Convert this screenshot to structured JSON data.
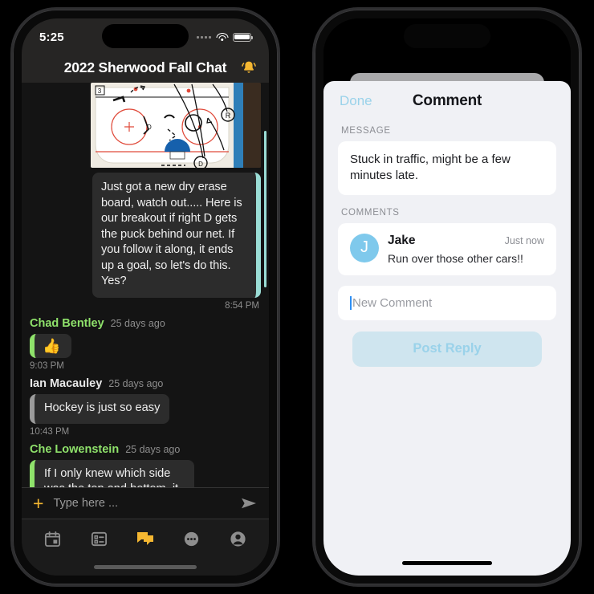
{
  "left_phone": {
    "status_bar": {
      "time": "5:25",
      "wifi_icon": "wifi-icon",
      "battery_icon": "battery-full-icon",
      "cellular_icon": "cellular-dots-icon"
    },
    "nav": {
      "title": "2022 Sherwood Fall Chat",
      "bell_icon": "bell-icon"
    },
    "messages": [
      {
        "type": "image",
        "name": "whiteboard-photo",
        "alt": "hockey rink breakout diagram on dry erase board"
      },
      {
        "type": "outgoing",
        "text": "Just got a new dry erase board, watch out..... Here is our breakout if right D gets the puck behind our net. If you follow it along, it ends up a goal, so let's do this. Yes?",
        "time": "8:54 PM",
        "accent": "#9bddd6"
      },
      {
        "type": "incoming",
        "author": "Chad Bentley",
        "ago": "25 days ago",
        "text": "👍",
        "time": "9:03 PM",
        "accent": "#8fe26b",
        "name_color": "#8fe26b",
        "is_reaction": true
      },
      {
        "type": "incoming",
        "author": "Ian Macauley",
        "ago": "25 days ago",
        "text": "Hockey is just so easy",
        "time": "10:43 PM",
        "accent": "#9b9b9b",
        "name_color": "#e8e8e8",
        "is_reaction": false
      },
      {
        "type": "incoming",
        "author": "Che Lowenstein",
        "ago": "25 days ago",
        "text": "If I only knew which side was the top and bottom, it would make sense more...",
        "time": "",
        "accent": "#8fe26b",
        "name_color": "#8fe26b",
        "is_reaction": false
      }
    ],
    "scroll_to_bottom": {
      "icon": "arrow-down-icon",
      "color": "#f5b731"
    },
    "composer": {
      "add_icon": "plus-icon",
      "placeholder": "Type here ...",
      "send_icon": "send-arrow-icon"
    },
    "tabs": [
      {
        "name": "tab-calendar",
        "icon": "calendar-icon",
        "active": false
      },
      {
        "name": "tab-tasks",
        "icon": "list-checklist-icon",
        "active": false
      },
      {
        "name": "tab-chat",
        "icon": "chat-bubbles-icon",
        "active": true
      },
      {
        "name": "tab-more",
        "icon": "ellipsis-circle-icon",
        "active": false
      },
      {
        "name": "tab-profile",
        "icon": "person-circle-icon",
        "active": false
      }
    ],
    "active_tab_color": "#f5b731"
  },
  "right_phone": {
    "sheet": {
      "done_label": "Done",
      "title": "Comment",
      "message_section_label": "MESSAGE",
      "message_text": "Stuck in traffic, might be a few minutes late.",
      "comments_section_label": "COMMENTS",
      "comments": [
        {
          "avatar_initial": "J",
          "avatar_color": "#7fc9ec",
          "author": "Jake",
          "when": "Just now",
          "text": "Run over those other cars!!"
        }
      ],
      "new_comment_placeholder": "New Comment",
      "post_button_label": "Post Reply",
      "done_color": "#9ad2ea",
      "post_button_bg": "#cfe5ef"
    }
  }
}
